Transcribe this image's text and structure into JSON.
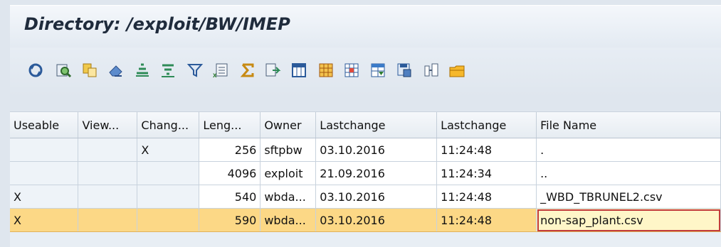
{
  "title": "Directory: /exploit/BW/IMEP",
  "toolbar": {
    "icons": [
      "refresh-icon",
      "details-icon",
      "copy-icon",
      "eraser-icon",
      "sort-ascending-icon",
      "sort-descending-icon",
      "filter-icon",
      "export-excel-icon",
      "total-icon",
      "print-preview-icon",
      "layout-icon",
      "grid-icon",
      "column-icon",
      "select-layout-icon",
      "save-layout-icon",
      "info-icon",
      "folder-icon"
    ]
  },
  "table": {
    "headers": [
      "Useable",
      "View...",
      "Chang...",
      "Leng...",
      "Owner",
      "Lastchange",
      "Lastchange",
      "File Name"
    ],
    "rows": [
      {
        "useable": "",
        "view": "",
        "changed": "X",
        "length": "256",
        "owner": "sftpbw",
        "date": "03.10.2016",
        "time": "11:24:48",
        "file": "."
      },
      {
        "useable": "",
        "view": "",
        "changed": "",
        "length": "4096",
        "owner": "exploit",
        "date": "21.09.2016",
        "time": "11:24:34",
        "file": ".."
      },
      {
        "useable": "X",
        "view": "",
        "changed": "",
        "length": "540",
        "owner": "wbda...",
        "date": "03.10.2016",
        "time": "11:24:48",
        "file": "_WBD_TBRUNEL2.csv"
      },
      {
        "useable": "X",
        "view": "",
        "changed": "",
        "length": "590",
        "owner": "wbda...",
        "date": "03.10.2016",
        "time": "11:24:48",
        "file": "non-sap_plant.csv"
      }
    ]
  },
  "colors": {
    "selected_row": "#fcd886",
    "accent_red": "#c23b3b"
  }
}
